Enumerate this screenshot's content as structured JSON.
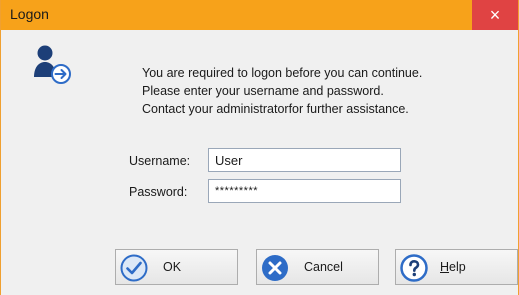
{
  "window": {
    "title": "Logon",
    "close_glyph": "×",
    "accent_color": "#f7a21a",
    "close_color": "#e04343"
  },
  "icon": "user-logon-icon",
  "message": {
    "line1": "You are required to logon before you can continue.",
    "line2": "Please enter your username and password.",
    "line3": "Contact your administratorfor further assistance."
  },
  "form": {
    "username_label": "Username:",
    "username_value": "User",
    "password_label": "Password:",
    "password_value": "*********"
  },
  "buttons": {
    "ok": {
      "label": "OK",
      "icon": "checkmark-icon"
    },
    "cancel": {
      "label": "Cancel",
      "icon": "cancel-x-icon"
    },
    "help": {
      "label": "Help",
      "icon": "question-icon"
    }
  }
}
